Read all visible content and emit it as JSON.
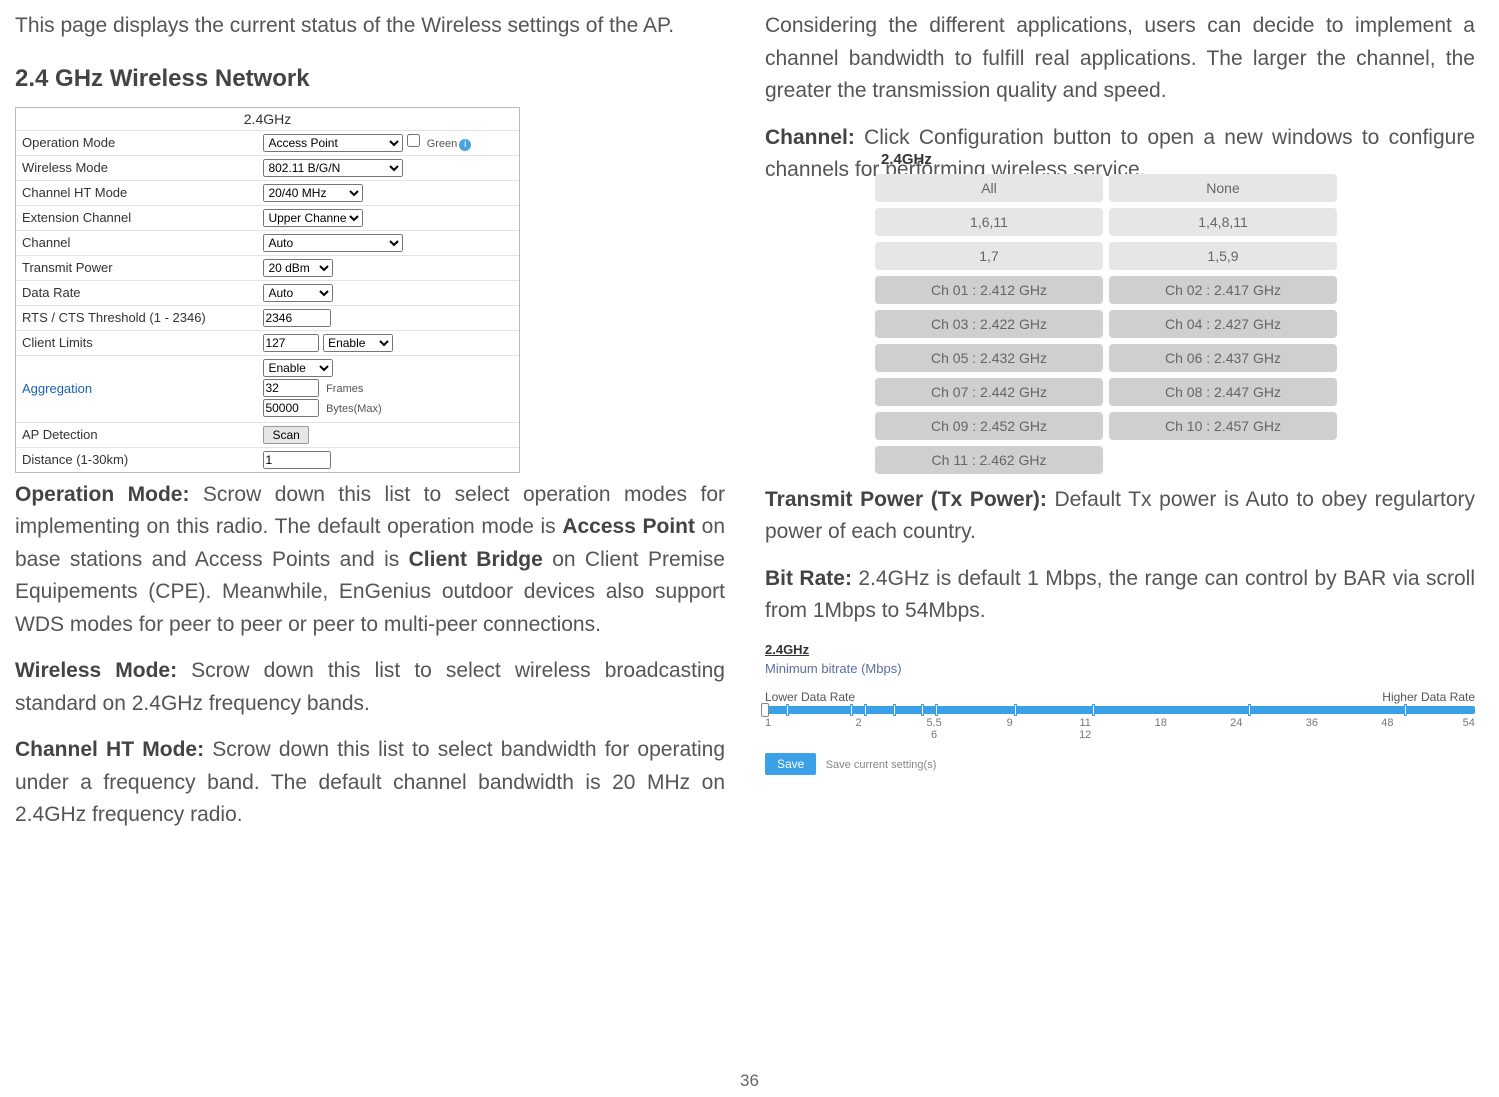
{
  "page_number": "36",
  "left": {
    "intro": "This page displays the current status of the Wireless settings of the AP.",
    "heading": "2.4 GHz Wireless Network",
    "settings": {
      "title": "2.4GHz",
      "rows": {
        "op_mode": {
          "label": "Operation Mode",
          "value": "Access Point",
          "green": "Green"
        },
        "wireless_mode": {
          "label": "Wireless Mode",
          "value": "802.11 B/G/N"
        },
        "ht_mode": {
          "label": "Channel HT Mode",
          "value": "20/40 MHz"
        },
        "ext_channel": {
          "label": "Extension Channel",
          "value": "Upper Channel"
        },
        "channel": {
          "label": "Channel",
          "value": "Auto"
        },
        "tx_power": {
          "label": "Transmit Power",
          "value": "20 dBm"
        },
        "data_rate": {
          "label": "Data Rate",
          "value": "Auto"
        },
        "rts": {
          "label": "RTS / CTS Threshold (1 - 2346)",
          "value": "2346"
        },
        "client_limits": {
          "label": "Client Limits",
          "value": "127",
          "enable": "Enable"
        },
        "aggregation": {
          "label": "Aggregation",
          "enable": "Enable",
          "frames_val": "32",
          "frames_lbl": "Frames",
          "bytes_val": "50000",
          "bytes_lbl": "Bytes(Max)"
        },
        "ap_detection": {
          "label": "AP Detection",
          "btn": "Scan"
        },
        "distance": {
          "label": "Distance (1-30km)",
          "value": "1"
        }
      }
    },
    "p_op_mode_1": "Operation Mode:",
    "p_op_mode_2": " Scrow down this list to select operation modes for implementing on this radio. The default operation mode is ",
    "p_op_mode_3": "Access Point",
    "p_op_mode_4": " on base stations and Access Points and is ",
    "p_op_mode_5": "Client Bridge",
    "p_op_mode_6": " on Client Premise Equipements (CPE). Meanwhile, EnGenius outdoor devices also support WDS modes for peer to peer or peer to multi-peer connections.",
    "p_wmode_1": "Wireless Mode:",
    "p_wmode_2": " Scrow down this list to select wireless broadcasting standard on 2.4GHz frequency bands.",
    "p_ht_1": "Channel HT Mode:",
    "p_ht_2": " Scrow down this list to select bandwidth for operating under a frequency band. The default channel bandwidth is 20 MHz on 2.4GHz frequency radio."
  },
  "right": {
    "p_cont": "Considering the different applications, users can decide to implement a channel bandwidth to fulfill real applications. The larger the channel, the greater the transmission quality and speed.",
    "p_channel_1": "Channel:",
    "p_channel_2": " Click Configuration button to open a new windows to configure channels for performing wireless service.",
    "channel_box": {
      "title": "2.4GHz",
      "buttons": [
        {
          "label": "All",
          "dark": false
        },
        {
          "label": "None",
          "dark": false
        },
        {
          "label": "1,6,11",
          "dark": false
        },
        {
          "label": "1,4,8,11",
          "dark": false
        },
        {
          "label": "1,7",
          "dark": false
        },
        {
          "label": "1,5,9",
          "dark": false
        },
        {
          "label": "Ch 01 : 2.412 GHz",
          "dark": true
        },
        {
          "label": "Ch 02 : 2.417 GHz",
          "dark": true
        },
        {
          "label": "Ch 03 : 2.422 GHz",
          "dark": true
        },
        {
          "label": "Ch 04 : 2.427 GHz",
          "dark": true
        },
        {
          "label": "Ch 05 : 2.432 GHz",
          "dark": true
        },
        {
          "label": "Ch 06 : 2.437 GHz",
          "dark": true
        },
        {
          "label": "Ch 07 : 2.442 GHz",
          "dark": true
        },
        {
          "label": "Ch 08 : 2.447 GHz",
          "dark": true
        },
        {
          "label": "Ch 09 : 2.452 GHz",
          "dark": true
        },
        {
          "label": "Ch 10 : 2.457 GHz",
          "dark": true
        },
        {
          "label": "Ch 11 : 2.462 GHz",
          "dark": true
        }
      ]
    },
    "p_tx_1": "Transmit Power (Tx Power):",
    "p_tx_2": " Default Tx power is Auto to obey regulartory power of each country.",
    "p_bit_1": "Bit Rate:",
    "p_bit_2": " 2.4GHz is default 1 Mbps, the range can control by BAR via scroll from 1Mbps to 54Mbps.",
    "bitrate": {
      "title": "2.4GHz",
      "sub": "Minimum bitrate (Mbps)",
      "low": "Lower Data Rate",
      "high": "Higher Data Rate",
      "scale": [
        "1",
        "2",
        "5.5 6",
        "9",
        "11 12",
        "18",
        "24",
        "36",
        "48",
        "54"
      ],
      "save_btn": "Save",
      "save_note": "Save current setting(s)"
    }
  }
}
